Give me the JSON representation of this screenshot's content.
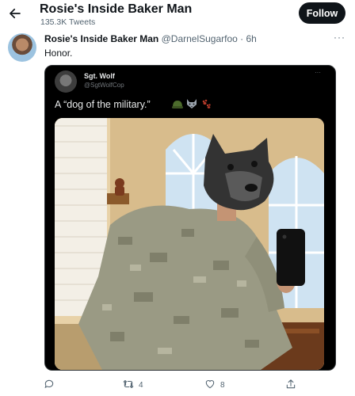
{
  "header": {
    "title": "Rosie's Inside Baker Man",
    "tweet_count": "135.3K Tweets",
    "follow_label": "Follow"
  },
  "tweet": {
    "display_name": "Rosie's Inside Baker Man",
    "handle_time": "@DarnelSugarfoo · 6h",
    "more": "···",
    "text": "Honor."
  },
  "quoted": {
    "display_name": "Sgt. Wolf",
    "handle": "@SgtWolfCop",
    "more": "···",
    "text": "A “dog of the military.”",
    "emojis": [
      "military-helmet",
      "wolf-face",
      "paw-prints"
    ]
  },
  "actions": {
    "retweets": "4",
    "likes": "8"
  },
  "colors": {
    "follow_bg": "#0f1419",
    "secondary_text": "#536471",
    "embed_bg": "#000000"
  }
}
